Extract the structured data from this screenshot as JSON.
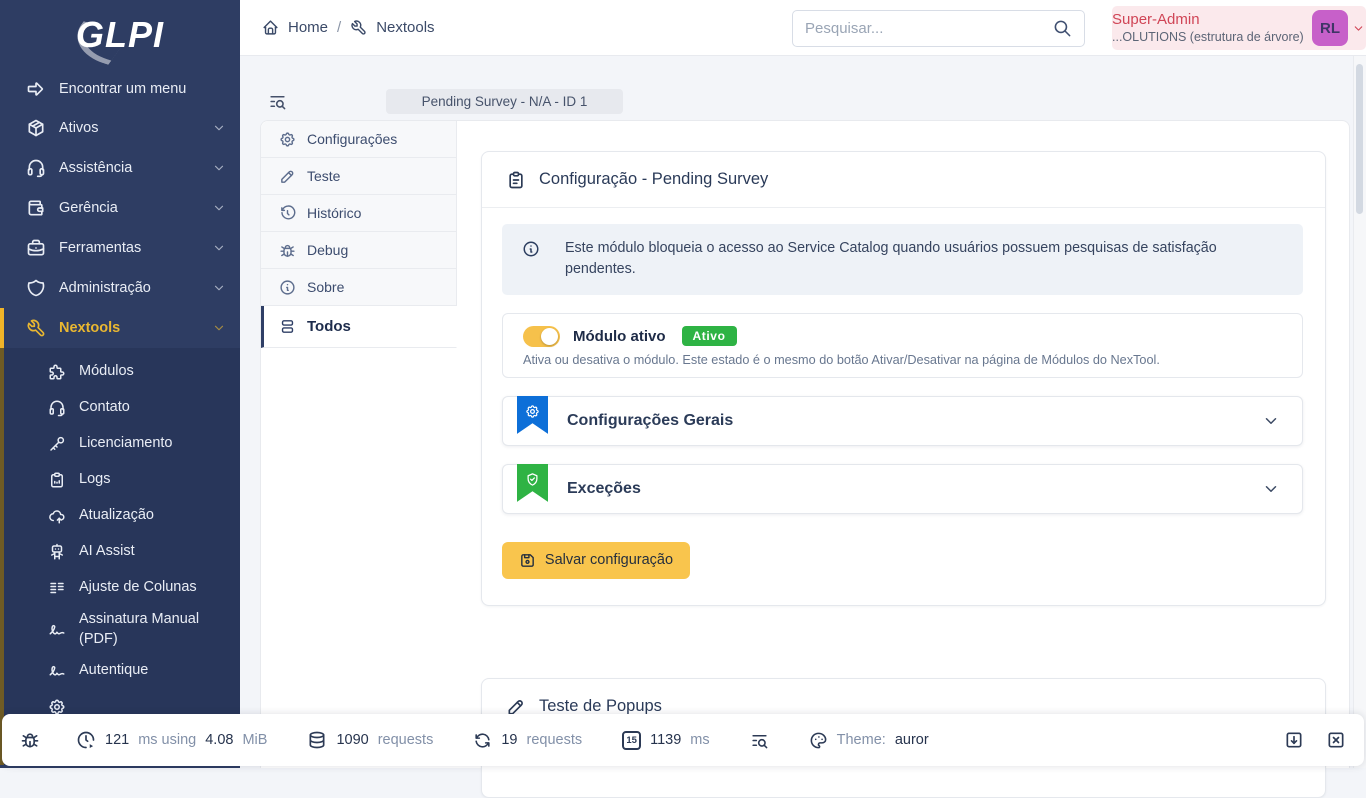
{
  "brand": {
    "logo": "GLPI"
  },
  "topbar": {
    "breadcrumb_home": "Home",
    "breadcrumb_separator": "/",
    "breadcrumb_current": "Nextools",
    "search_placeholder": "Pesquisar...",
    "user_profile": "Super-Admin",
    "user_entity": "...OLUTIONS (estrutura de árvore)",
    "user_initials": "RL"
  },
  "sidebar": {
    "find_menu_label": "Encontrar um menu",
    "items": [
      {
        "label": "Ativos",
        "icon": "package-icon"
      },
      {
        "label": "Assistência",
        "icon": "headset-icon"
      },
      {
        "label": "Gerência",
        "icon": "wallet-icon"
      },
      {
        "label": "Ferramentas",
        "icon": "briefcase-icon"
      },
      {
        "label": "Administração",
        "icon": "shield-icon"
      },
      {
        "label": "Nextools",
        "icon": "wrench-icon",
        "active": true
      }
    ],
    "submenu": [
      {
        "label": "Módulos",
        "icon": "puzzle-icon"
      },
      {
        "label": "Contato",
        "icon": "headset-icon"
      },
      {
        "label": "Licenciamento",
        "icon": "key-icon"
      },
      {
        "label": "Logs",
        "icon": "clipboard-chart-icon"
      },
      {
        "label": "Atualização",
        "icon": "cloud-up-icon"
      },
      {
        "label": "AI Assist",
        "icon": "robot-icon"
      },
      {
        "label": "Ajuste de Colunas",
        "icon": "columns-icon"
      },
      {
        "label": "Assinatura Manual (PDF)",
        "icon": "signature-icon"
      },
      {
        "label": "Autentique",
        "icon": "signature-icon"
      }
    ]
  },
  "content": {
    "object_tab": "Pending Survey -  N/A - ID 1",
    "tabs": [
      {
        "label": "Configurações",
        "icon": "gear-icon"
      },
      {
        "label": "Teste",
        "icon": "pen-icon"
      },
      {
        "label": "Histórico",
        "icon": "history-icon"
      },
      {
        "label": "Debug",
        "icon": "bug-icon"
      },
      {
        "label": "Sobre",
        "icon": "info-icon"
      },
      {
        "label": "Todos",
        "icon": "stack-icon",
        "active": true
      }
    ],
    "config_card": {
      "title": "Configuração - Pending Survey",
      "info_text": "Este módulo bloqueia o acesso ao Service Catalog quando usuários possuem pesquisas de satisfação pendentes.",
      "module_label": "Módulo ativo",
      "module_badge": "Ativo",
      "module_state_on": true,
      "module_description": "Ativa ou desativa o módulo. Este estado é o mesmo do botão Ativar/Desativar na página de Módulos do NexTool.",
      "section_general": "Configurações Gerais",
      "section_exceptions": "Exceções",
      "save_label": "Salvar configuração"
    },
    "popup_card": {
      "title": "Teste de Popups"
    }
  },
  "statusbar": {
    "time_value": "121",
    "time_unit": "ms using",
    "mem_value": "4.08",
    "mem_unit": "MiB",
    "sql_count": "1090",
    "sql_unit": "requests",
    "ajax_count": "19",
    "ajax_unit": "requests",
    "load_value": "1139",
    "load_unit": "ms",
    "timer_glyph": "15",
    "theme_label": "Theme:",
    "theme_value": "auror"
  },
  "colors": {
    "sidebar_bg": "#2e3d63",
    "accent_yellow": "#f0b429",
    "badge_green": "#2eb344",
    "ribbon_blue": "#0d6fd8",
    "ribbon_green": "#2fb344",
    "avatar_purple": "#c760c9",
    "profile_red": "#d04556",
    "save_button": "#f9c54d"
  }
}
